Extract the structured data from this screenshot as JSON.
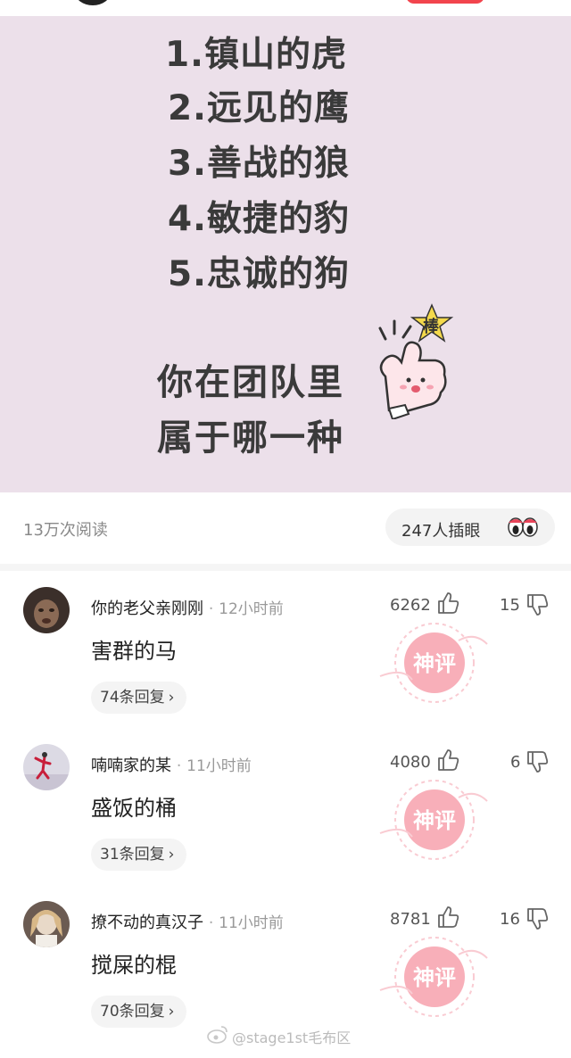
{
  "post": {
    "options": [
      "1.镇山的虎",
      "2.远见的鹰",
      "3.善战的狼",
      "4.敏捷的豹",
      "5.忠诚的狗"
    ],
    "question_line1": "你在团队里",
    "question_line2": "属于哪一种",
    "sticker_text": "棒"
  },
  "stats": {
    "views": "13万次阅读",
    "poke_label": "247人插眼"
  },
  "comments": [
    {
      "user": "你的老父亲刚刚",
      "time": "12小时前",
      "likes": "6262",
      "dislikes": "15",
      "text": "害群的马",
      "replies": "74条回复",
      "stamp": "神评"
    },
    {
      "user": "喃喃家的某",
      "time": "11小时前",
      "likes": "4080",
      "dislikes": "6",
      "text": "盛饭的桶",
      "replies": "31条回复",
      "stamp": "神评"
    },
    {
      "user": "撩不动的真汉子",
      "time": "11小时前",
      "likes": "8781",
      "dislikes": "16",
      "text": "搅屎的棍",
      "replies": "70条回复",
      "stamp": "神评"
    }
  ],
  "watermark": "@stage1st毛布区",
  "colors": {
    "post_bg": "#ece0ea",
    "stamp": "#f07a8a",
    "accent": "#f2444d"
  }
}
